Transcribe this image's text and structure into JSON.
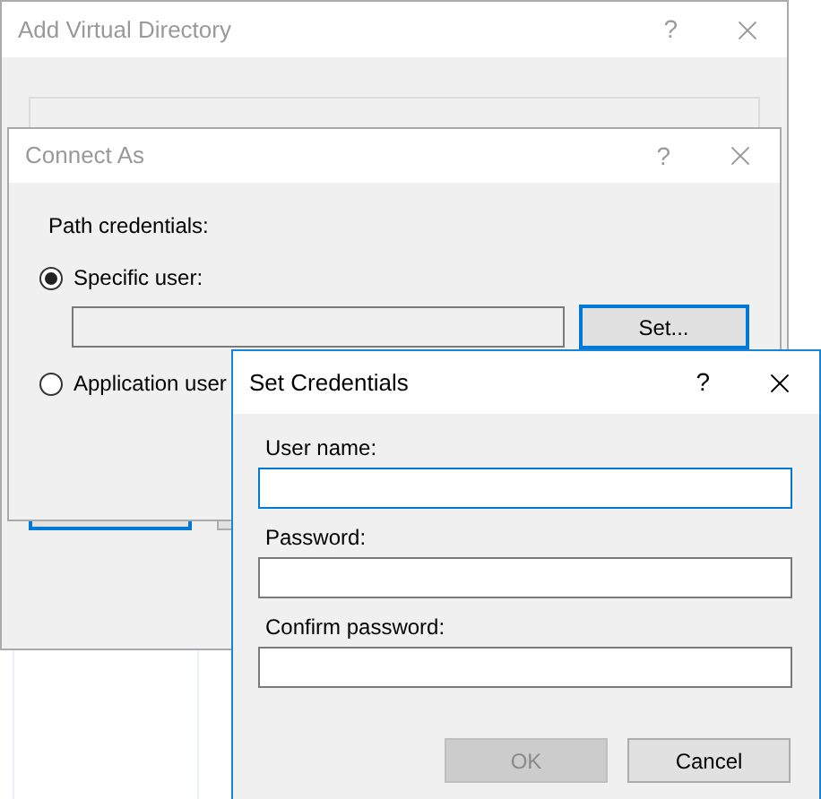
{
  "windows": [
    {
      "kind": "virtual_directory",
      "title": "Add Virtual Directory",
      "active": false,
      "help": "?"
    },
    {
      "kind": "connect_as",
      "title": "Connect As",
      "active": false,
      "help": "?",
      "section_label": "Path credentials:",
      "options": [
        {
          "label": "Specific user:",
          "selected": true
        },
        {
          "label": "Application user",
          "selected": false
        }
      ],
      "set_button": "Set..."
    },
    {
      "kind": "set_credentials",
      "title": "Set Credentials",
      "active": true,
      "help": "?",
      "fields": [
        {
          "label": "User name:",
          "focused": true
        },
        {
          "label": "Password:",
          "focused": false
        },
        {
          "label": "Confirm password:",
          "focused": false
        }
      ],
      "buttons": [
        {
          "label": "OK",
          "disabled": true
        },
        {
          "label": "Cancel",
          "disabled": false
        }
      ]
    }
  ]
}
